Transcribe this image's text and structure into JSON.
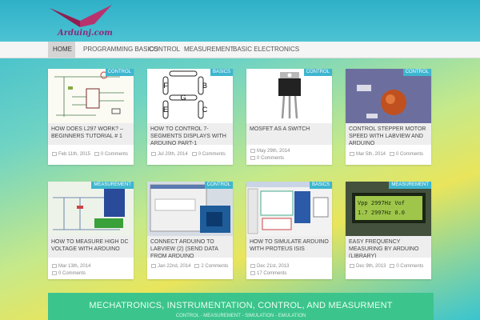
{
  "site": {
    "logo_text": "Arduinj.com"
  },
  "nav": [
    {
      "label": "HOME"
    },
    {
      "label": "PROGRAMMING BASICS"
    },
    {
      "label": "CONTROL"
    },
    {
      "label": "MEASUREMENT"
    },
    {
      "label": "BASIC ELECTRONICS"
    }
  ],
  "posts": [
    {
      "badge": "CONTROL",
      "title": "HOW DOES L297 WORK? – BEGINNERS TUTORIAL # 1",
      "date": "Feb 11th, 2015",
      "comments": "0 Comments"
    },
    {
      "badge": "BASICS",
      "title": "HOW TO CONTROL 7-SEGMENTS DISPLAYS WITH ARDUINO PART-1",
      "date": "Jul 20th, 2014",
      "comments": "0 Comments"
    },
    {
      "badge": "CONTROL",
      "title": "MOSFET AS A SWITCH",
      "date": "May 29th, 2014",
      "comments": "0 Comments"
    },
    {
      "badge": "CONTROL",
      "title": "CONTROL STEPPER MOTOR SPEED WITH LABVIEW AND ARDUINO",
      "date": "Mar 5th, 2014",
      "comments": "0 Comments"
    },
    {
      "badge": "MEASUREMENT",
      "title": "HOW TO MEASURE HIGH DC VOLTAGE WITH ARDUINO",
      "date": "Mar 13th, 2014",
      "comments": "0 Comments"
    },
    {
      "badge": "CONTROL",
      "title": "CONNECT ARDUINO TO LABVIEW (2) (SEND DATA FROM ARDUINO",
      "date": "Jan 22nd, 2014",
      "comments": "2 Comments"
    },
    {
      "badge": "BASICS",
      "title": "HOW TO SIMULATE ARDUINO WITH PROTEUS ISIS",
      "date": "Dec 21st, 2013",
      "comments": "17 Comments"
    },
    {
      "badge": "MEASUREMENT",
      "title": "EASY FREQUENCY MEASURING BY ARDUINO (LIBRARY)",
      "date": "Dec 9th, 2013",
      "comments": "0 Comments"
    }
  ],
  "segment_letters": {
    "f": "F",
    "b": "B",
    "g": "G",
    "e": "E",
    "c": "C"
  },
  "lcd": {
    "line1": "Vpp  2997Hz  Vof",
    "line2": "1.7  2997Hz  0.0"
  },
  "footer": {
    "title": "MECHATRONICS, INSTRUMENTATION, CONTROL, AND MEASURMENT",
    "subtitle": "CONTROL - MEASUREMENT - SIMULATION - EMULATION"
  },
  "colors": {
    "badge": "#3fb6cf",
    "footer": "#3cc48d",
    "header": "#2fb0c8"
  }
}
